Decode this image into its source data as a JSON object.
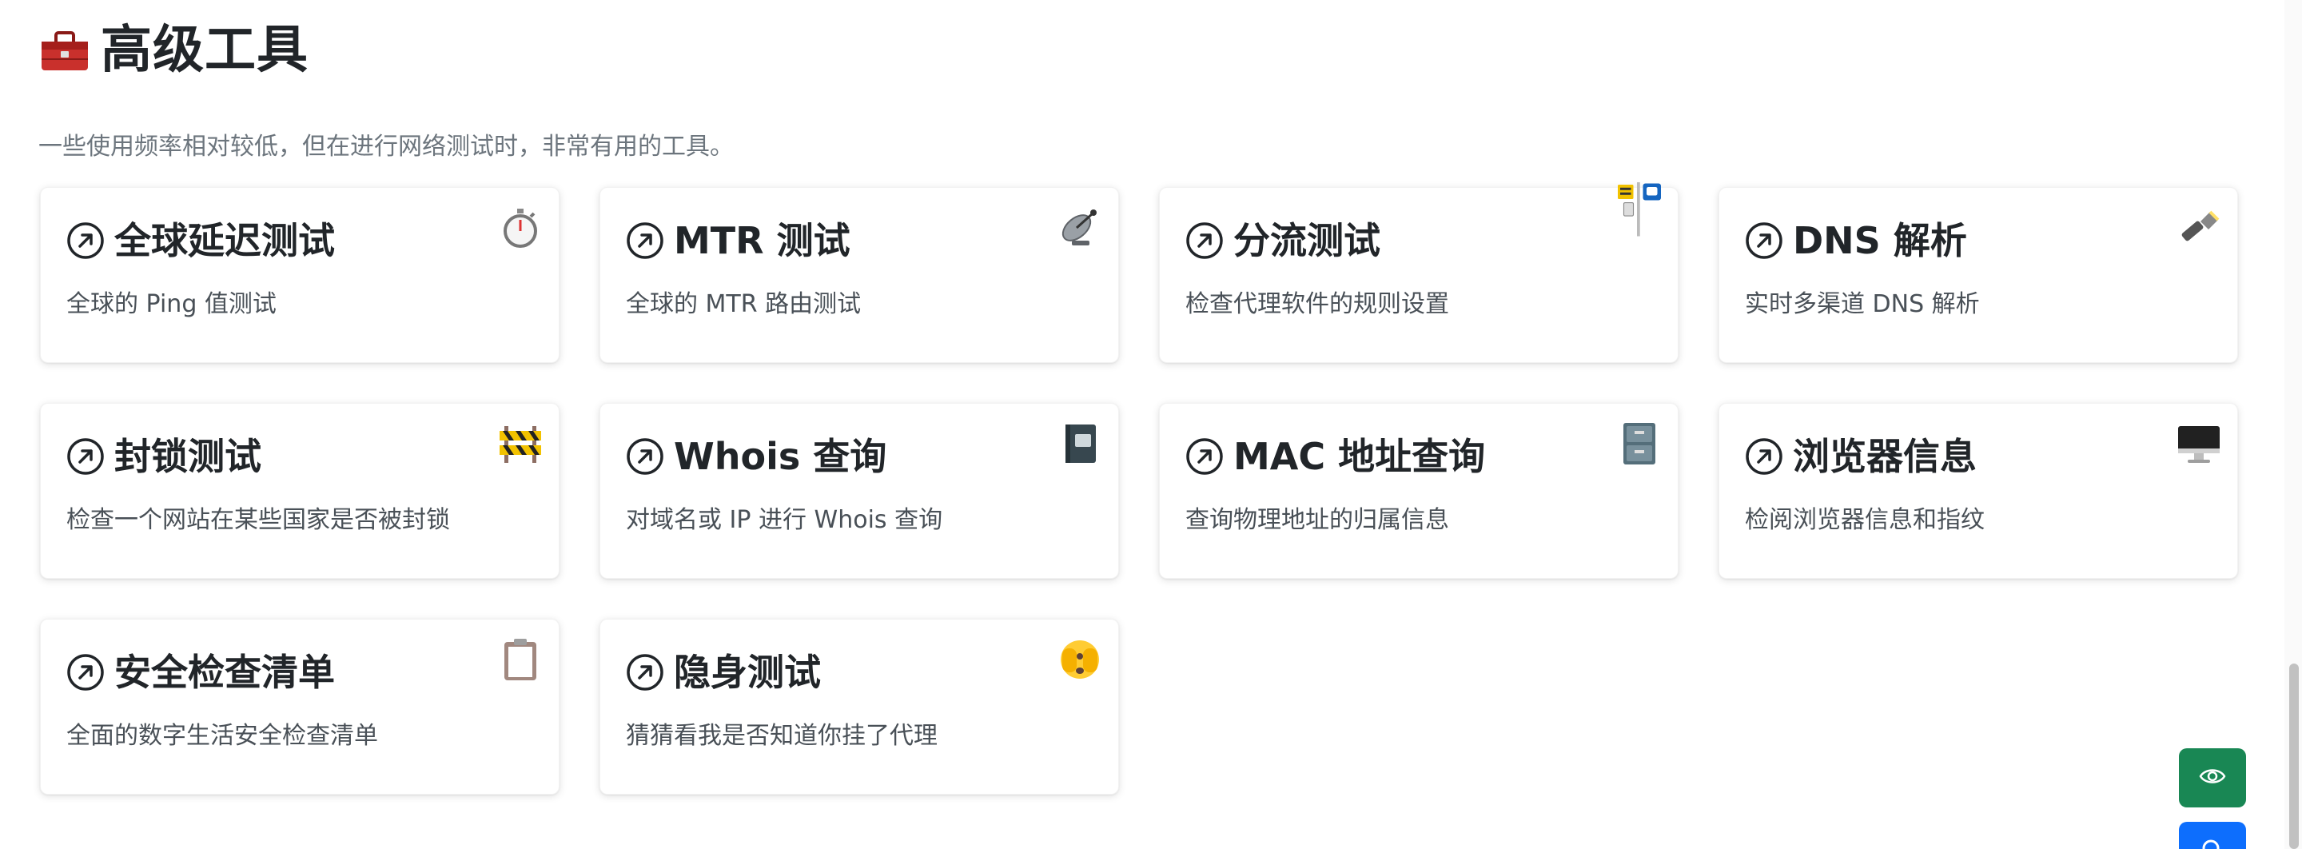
{
  "section": {
    "icon": "toolbox-icon",
    "title": "高级工具",
    "description": "一些使用频率相对较低，但在进行网络测试时，非常有用的工具。"
  },
  "cards": [
    {
      "title": "全球延迟测试",
      "desc": "全球的 Ping 值测试",
      "icon": "stopwatch-icon"
    },
    {
      "title": "MTR 测试",
      "desc": "全球的 MTR 路由测试",
      "icon": "satellite-dish-icon"
    },
    {
      "title": "分流测试",
      "desc": "检查代理软件的规则设置",
      "icon": "bus-stop-icon"
    },
    {
      "title": "DNS 解析",
      "desc": "实时多渠道 DNS 解析",
      "icon": "flashlight-icon"
    },
    {
      "title": "封锁测试",
      "desc": "检查一个网站在某些国家是否被封锁",
      "icon": "construction-barrier-icon"
    },
    {
      "title": "Whois 查询",
      "desc": "对域名或 IP 进行 Whois 查询",
      "icon": "notebook-icon"
    },
    {
      "title": "MAC 地址查询",
      "desc": "查询物理地址的归属信息",
      "icon": "file-cabinet-icon"
    },
    {
      "title": "浏览器信息",
      "desc": "检阅浏览器信息和指纹",
      "icon": "desktop-computer-icon"
    },
    {
      "title": "安全检查清单",
      "desc": "全面的数字生活安全检查清单",
      "icon": "clipboard-icon"
    },
    {
      "title": "隐身测试",
      "desc": "猜猜看我是否知道你挂了代理",
      "icon": "peeking-face-icon"
    }
  ],
  "floating_buttons": [
    {
      "icon": "eye-icon",
      "color": "#198754"
    },
    {
      "icon": "search-icon",
      "color": "#0d6efd"
    }
  ]
}
